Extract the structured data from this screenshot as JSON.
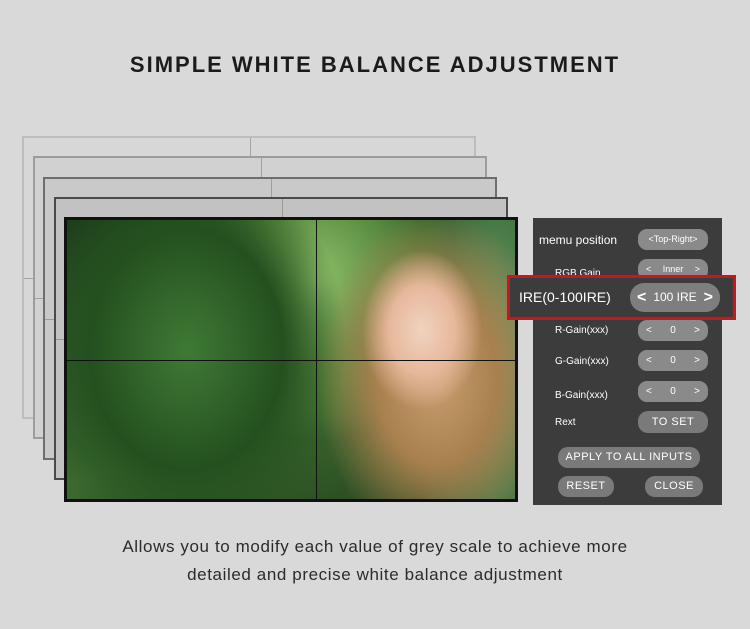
{
  "title": "SIMPLE WHITE BALANCE ADJUSTMENT",
  "menu": {
    "position_label": "memu position",
    "position_value": "<Top-Right>",
    "rgb_gain_label": "RGB Gain",
    "rgb_gain_value": "Inner",
    "ire_label": "IRE(0-100IRE)",
    "ire_value": "100 IRE",
    "r_gain_label": "R-Gain(xxx)",
    "r_gain_value": "0",
    "g_gain_label": "G-Gain(xxx)",
    "g_gain_value": "0",
    "b_gain_label": "B-Gain(xxx)",
    "b_gain_value": "0",
    "rext_label": "Rext",
    "to_set_label": "TO SET",
    "apply_all_label": "APPLY TO ALL INPUTS",
    "reset_label": "RESET",
    "close_label": "CLOSE",
    "decrease_glyph": "<",
    "increase_glyph": ">"
  },
  "caption": {
    "line1": "Allows you to modify each value of grey scale to achieve more",
    "line2": "detailed and precise white balance adjustment"
  },
  "colors": {
    "background": "#d9d9d9",
    "panel": "#3c3c3c",
    "highlight_border": "#c8161b",
    "button": "#7a7a7a"
  }
}
